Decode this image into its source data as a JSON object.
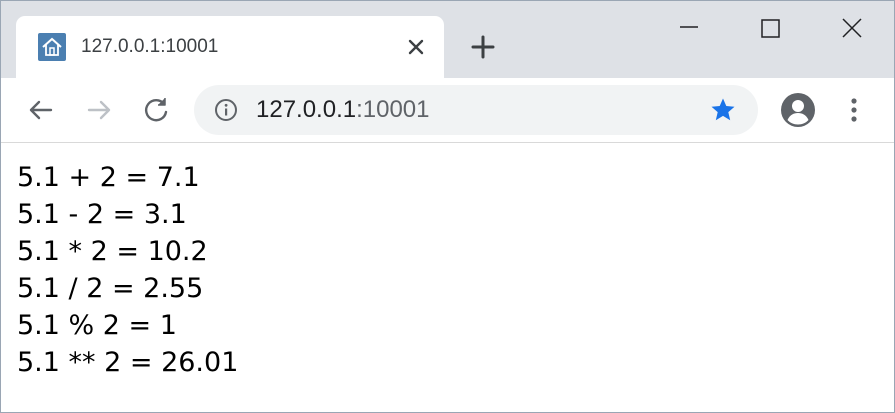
{
  "browser": {
    "tab": {
      "title": "127.0.0.1:10001",
      "favicon": "home-icon"
    },
    "address_bar": {
      "host": "127.0.0.1",
      "port": ":10001"
    },
    "colors": {
      "tabstrip": "#dee1e6",
      "favicon": "#4b7fb1",
      "star": "#1a73e8"
    }
  },
  "page": {
    "lines": [
      "5.1 + 2 = 7.1",
      "5.1 - 2 = 3.1",
      "5.1 * 2 = 10.2",
      "5.1 / 2 = 2.55",
      "5.1 % 2 = 1",
      "5.1 ** 2 = 26.01"
    ]
  }
}
